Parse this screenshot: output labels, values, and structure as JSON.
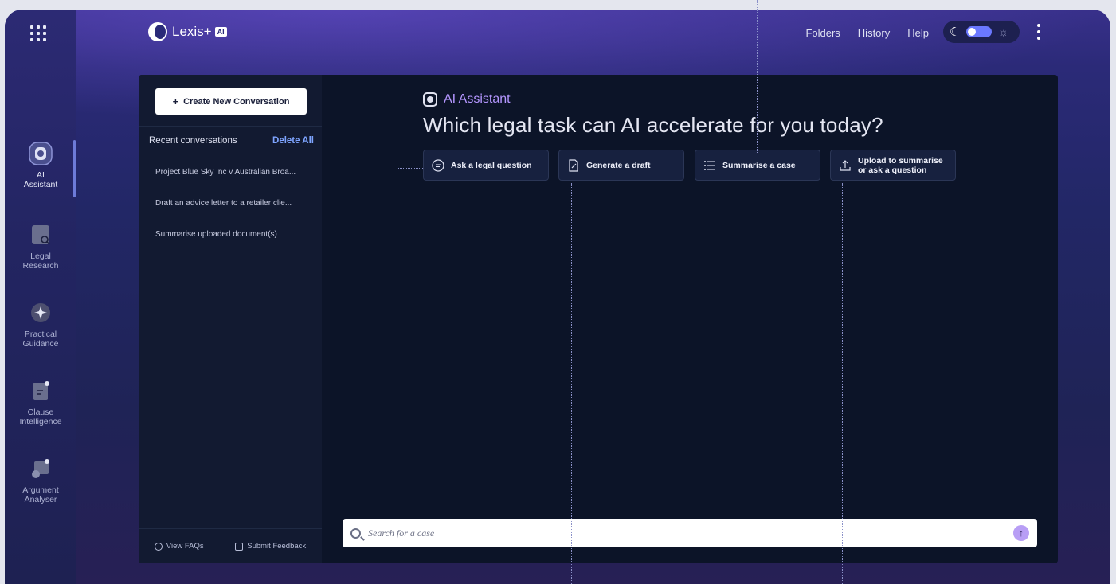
{
  "brand": {
    "name": "Lexis+",
    "badge": "AI"
  },
  "topbar": {
    "links": [
      "Folders",
      "History",
      "Help"
    ],
    "moon_icon": "moon-icon",
    "sun_icon": "sun-icon"
  },
  "nav": {
    "items": [
      {
        "label1": "AI",
        "label2": "Assistant",
        "icon": "ai-assistant-icon",
        "active": true
      },
      {
        "label1": "Legal",
        "label2": "Research",
        "icon": "legal-research-icon",
        "active": false
      },
      {
        "label1": "Practical",
        "label2": "Guidance",
        "icon": "practical-guidance-icon",
        "active": false
      },
      {
        "label1": "Clause",
        "label2": "Intelligence",
        "icon": "clause-intelligence-icon",
        "active": false
      },
      {
        "label1": "Argument",
        "label2": "Analyser",
        "icon": "argument-analyser-icon",
        "active": false
      }
    ]
  },
  "conversations": {
    "create_label": "Create New Conversation",
    "header": "Recent conversations",
    "delete_all": "Delete All",
    "items": [
      "Project Blue Sky Inc v Australian Broa...",
      "Draft an advice letter to a retailer clie...",
      "Summarise uploaded document(s)"
    ],
    "footer": {
      "faq": "View FAQs",
      "feedback": "Submit Feedback"
    }
  },
  "main": {
    "assistant_label": "AI Assistant",
    "headline": "Which legal task can AI accelerate for you today?",
    "chips": [
      {
        "label": "Ask a legal question",
        "icon": "chat-bubble-icon"
      },
      {
        "label": "Generate a draft",
        "icon": "draft-document-icon"
      },
      {
        "label": "Summarise a case",
        "icon": "list-icon"
      },
      {
        "label": "Upload to summarise or ask a question",
        "line1": "Upload to summarise",
        "line2": "or ask a question",
        "icon": "upload-icon"
      }
    ],
    "search": {
      "placeholder": "Search for a case"
    }
  },
  "colors": {
    "accent": "#b89ef5",
    "link": "#7ea4ff",
    "panel": "#0c1428",
    "sidebar": "#121a31"
  }
}
